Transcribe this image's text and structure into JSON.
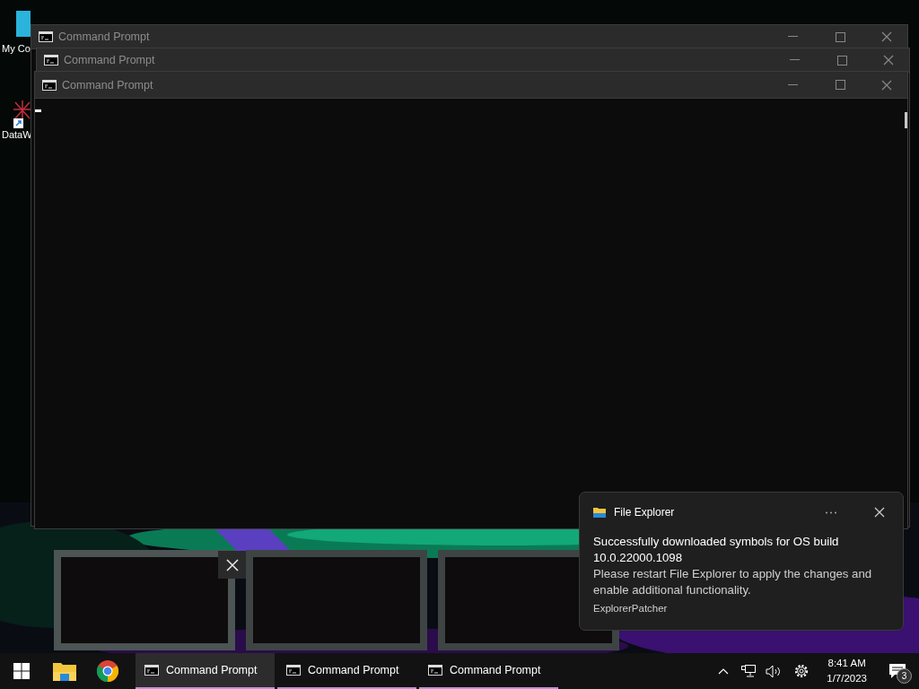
{
  "desktop_icons": [
    {
      "label": "My Co"
    },
    {
      "label": "DataW"
    }
  ],
  "windows": [
    {
      "title": "Command Prompt"
    },
    {
      "title": "Command Prompt"
    },
    {
      "title": "Command Prompt"
    }
  ],
  "thumbnail_previews": [
    {
      "selected": true
    },
    {
      "selected": false
    },
    {
      "selected": false
    }
  ],
  "notification": {
    "app": "File Explorer",
    "title": "Successfully downloaded symbols for OS build 10.0.22000.1098",
    "body": "Please restart File Explorer to apply the changes and enable additional functionality.",
    "source": "ExplorerPatcher"
  },
  "taskbar": {
    "tasks": [
      {
        "label": "Command Prompt",
        "selected": true
      },
      {
        "label": "Command Prompt",
        "selected": false
      },
      {
        "label": "Command Prompt",
        "selected": false
      }
    ],
    "time": "8:41 AM",
    "date": "1/7/2023",
    "notification_count": "3"
  }
}
